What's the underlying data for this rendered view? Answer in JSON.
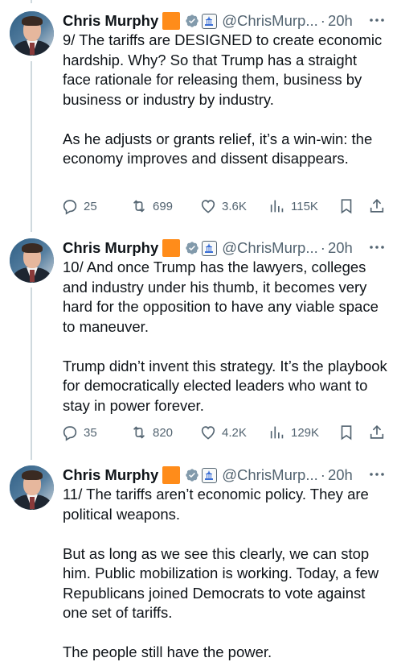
{
  "tweets": [
    {
      "name": "Chris Murphy",
      "handle": "@ChrisMurp...",
      "separator": "·",
      "time": "20h",
      "paragraphs": [
        "9/ The tariffs are DESIGNED to create economic hardship. Why? So that Trump has a straight face rationale for releasing them, business by business or industry by industry.",
        "As he adjusts or grants relief, it’s a win-win: the economy improves and dissent disappears."
      ],
      "replies": "25",
      "reposts": "699",
      "likes": "3.6K",
      "views": "115K"
    },
    {
      "name": "Chris Murphy",
      "handle": "@ChrisMurp...",
      "separator": "·",
      "time": "20h",
      "paragraphs": [
        "10/ And once Trump has the lawyers, colleges and industry under his thumb, it becomes very hard for the opposition to have any viable space to maneuver.",
        "Trump didn’t invent this strategy. It’s the playbook for democratically elected leaders who want to stay in power forever."
      ],
      "replies": "35",
      "reposts": "820",
      "likes": "4.2K",
      "views": "129K"
    },
    {
      "name": "Chris Murphy",
      "handle": "@ChrisMurp...",
      "separator": "·",
      "time": "20h",
      "paragraphs": [
        "11/ The tariffs aren’t economic policy. They are political weapons.",
        "But as long as we see this clearly, we can stop him. Public mobilization is working. Today, a few Republicans joined Democrats to vote against one set of tariffs.",
        "The people still have the power."
      ]
    }
  ],
  "colors": {
    "text": "#0f1419",
    "muted": "#536471",
    "badge": "#ff8c1a",
    "verified": "#829aab",
    "thread_line": "#cfd9de"
  },
  "icons": [
    "reply-icon",
    "repost-icon",
    "like-icon",
    "views-icon",
    "bookmark-icon",
    "share-icon",
    "verified-badge-icon",
    "capitol-icon",
    "more-icon"
  ]
}
